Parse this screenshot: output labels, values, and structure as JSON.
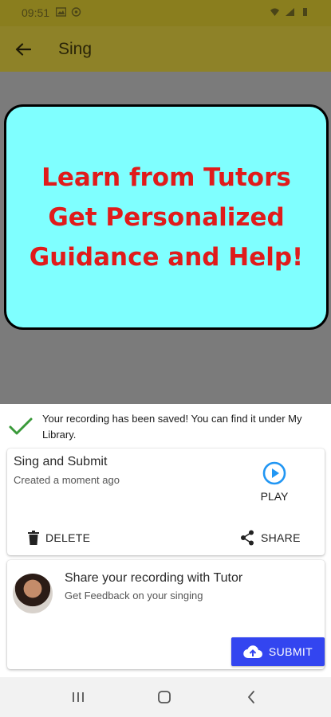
{
  "status_bar": {
    "time": "09:51"
  },
  "app_bar": {
    "title": "Sing"
  },
  "promo": {
    "lines": [
      "Learn from Tutors",
      "Get Personalized",
      "Guidance and Help!"
    ]
  },
  "saved_notice": {
    "text": "Your recording has been saved! You can find it under My Library."
  },
  "recording": {
    "title": "Sing and Submit",
    "subtitle": "Created a moment ago",
    "play_label": "PLAY",
    "delete_label": "DELETE",
    "share_label": "SHARE"
  },
  "tutor": {
    "title": "Share your recording with Tutor",
    "subtitle": "Get Feedback on your singing",
    "submit_label": "SUBMIT"
  },
  "icons": {
    "back": "arrow-left-icon",
    "check": "check-icon",
    "play": "play-circle-icon",
    "delete": "trash-icon",
    "share": "share-icon",
    "submit": "cloud-upload-icon"
  },
  "colors": {
    "app_bar": "#8e8228",
    "promo_bg": "#7fffff",
    "promo_text": "#e01b1b",
    "check": "#3a9a3a",
    "play": "#2196f3",
    "submit_bg": "#3345f0"
  }
}
